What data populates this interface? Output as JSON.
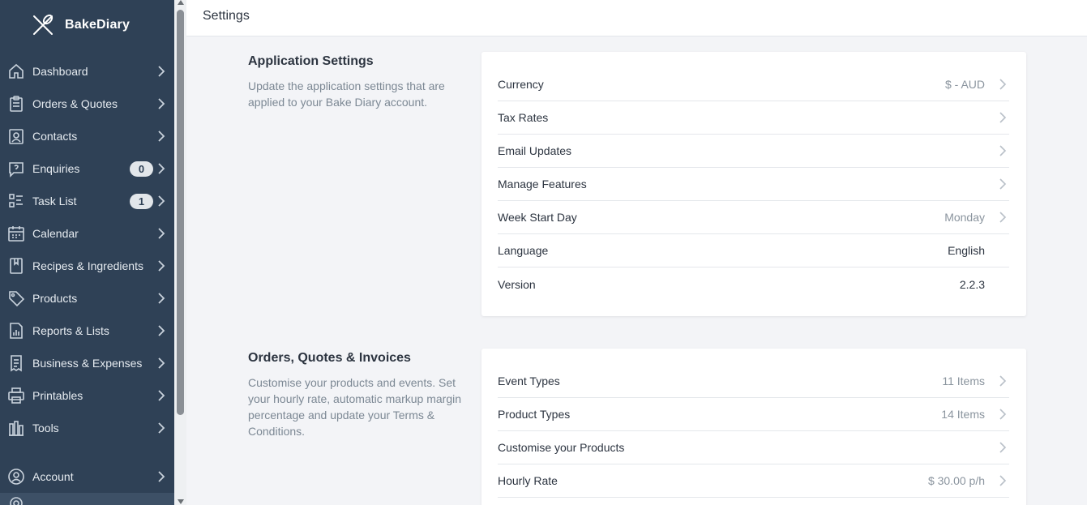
{
  "brand": {
    "name": "BakeDiary"
  },
  "header": {
    "title": "Settings"
  },
  "sidebar": {
    "items": [
      {
        "label": "Dashboard",
        "icon": "home-icon"
      },
      {
        "label": "Orders & Quotes",
        "icon": "clipboard-icon"
      },
      {
        "label": "Contacts",
        "icon": "contact-card-icon"
      },
      {
        "label": "Enquiries",
        "icon": "question-bubble-icon",
        "badge": "0"
      },
      {
        "label": "Task List",
        "icon": "checklist-icon",
        "badge": "1"
      },
      {
        "label": "Calendar",
        "icon": "calendar-icon"
      },
      {
        "label": "Recipes & Ingredients",
        "icon": "recipe-book-icon"
      },
      {
        "label": "Products",
        "icon": "tag-icon"
      },
      {
        "label": "Reports & Lists",
        "icon": "report-chart-icon"
      },
      {
        "label": "Business & Expenses",
        "icon": "receipt-icon"
      },
      {
        "label": "Printables",
        "icon": "printer-icon"
      },
      {
        "label": "Tools",
        "icon": "tools-icon"
      },
      {
        "label": "Account",
        "icon": "account-icon"
      }
    ]
  },
  "sections": [
    {
      "title": "Application Settings",
      "description": "Update the application settings that are applied to your Bake Diary account.",
      "rows": [
        {
          "label": "Currency",
          "value": "$ - AUD"
        },
        {
          "label": "Tax Rates",
          "value": ""
        },
        {
          "label": "Email Updates",
          "value": ""
        },
        {
          "label": "Manage Features",
          "value": ""
        },
        {
          "label": "Week Start Day",
          "value": "Monday"
        },
        {
          "label": "Language",
          "value": "English"
        },
        {
          "label": "Version",
          "value": "2.2.3"
        }
      ]
    },
    {
      "title": "Orders, Quotes & Invoices",
      "description": "Customise your products and events. Set your hourly rate, automatic markup margin percentage and update your Terms & Conditions.",
      "rows": [
        {
          "label": "Event Types",
          "value": "11 Items"
        },
        {
          "label": "Product Types",
          "value": "14 Items"
        },
        {
          "label": "Customise your Products",
          "value": ""
        },
        {
          "label": "Hourly Rate",
          "value": "$ 30.00 p/h"
        }
      ]
    }
  ],
  "colors": {
    "sidebar": "#2f4156",
    "background": "#f3f4f7",
    "card": "#ffffff"
  }
}
